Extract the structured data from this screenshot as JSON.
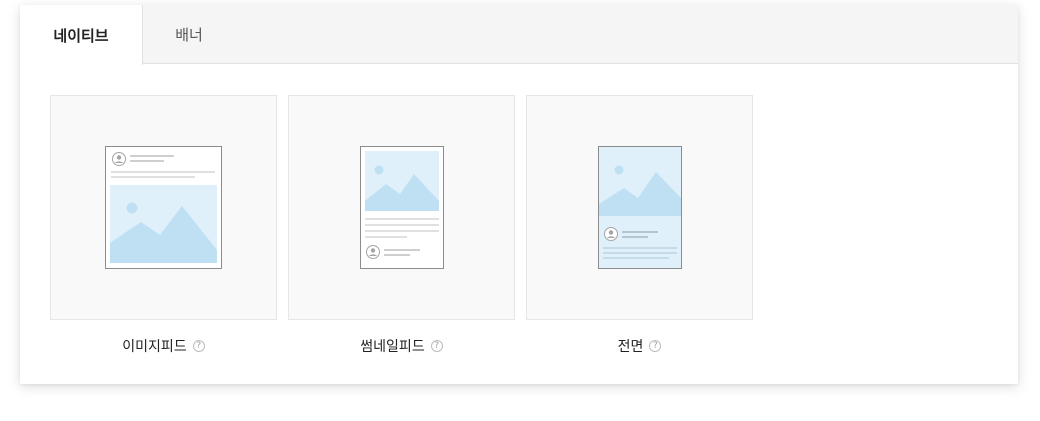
{
  "tabs": [
    {
      "label": "네이티브",
      "active": true
    },
    {
      "label": "배너",
      "active": false
    }
  ],
  "formats": [
    {
      "label": "이미지피드",
      "help_icon": "question-circle-icon",
      "preview_icon": "image-feed-layout-icon"
    },
    {
      "label": "썸네일피드",
      "help_icon": "question-circle-icon",
      "preview_icon": "thumbnail-feed-layout-icon"
    },
    {
      "label": "전면",
      "help_icon": "question-circle-icon",
      "preview_icon": "fullscreen-layout-icon"
    }
  ],
  "colors": {
    "image_fill": "#bfe0f2",
    "image_bg": "#dff0fa",
    "text_line": "#dcdcdc",
    "tab_bg": "#f5f5f5"
  }
}
